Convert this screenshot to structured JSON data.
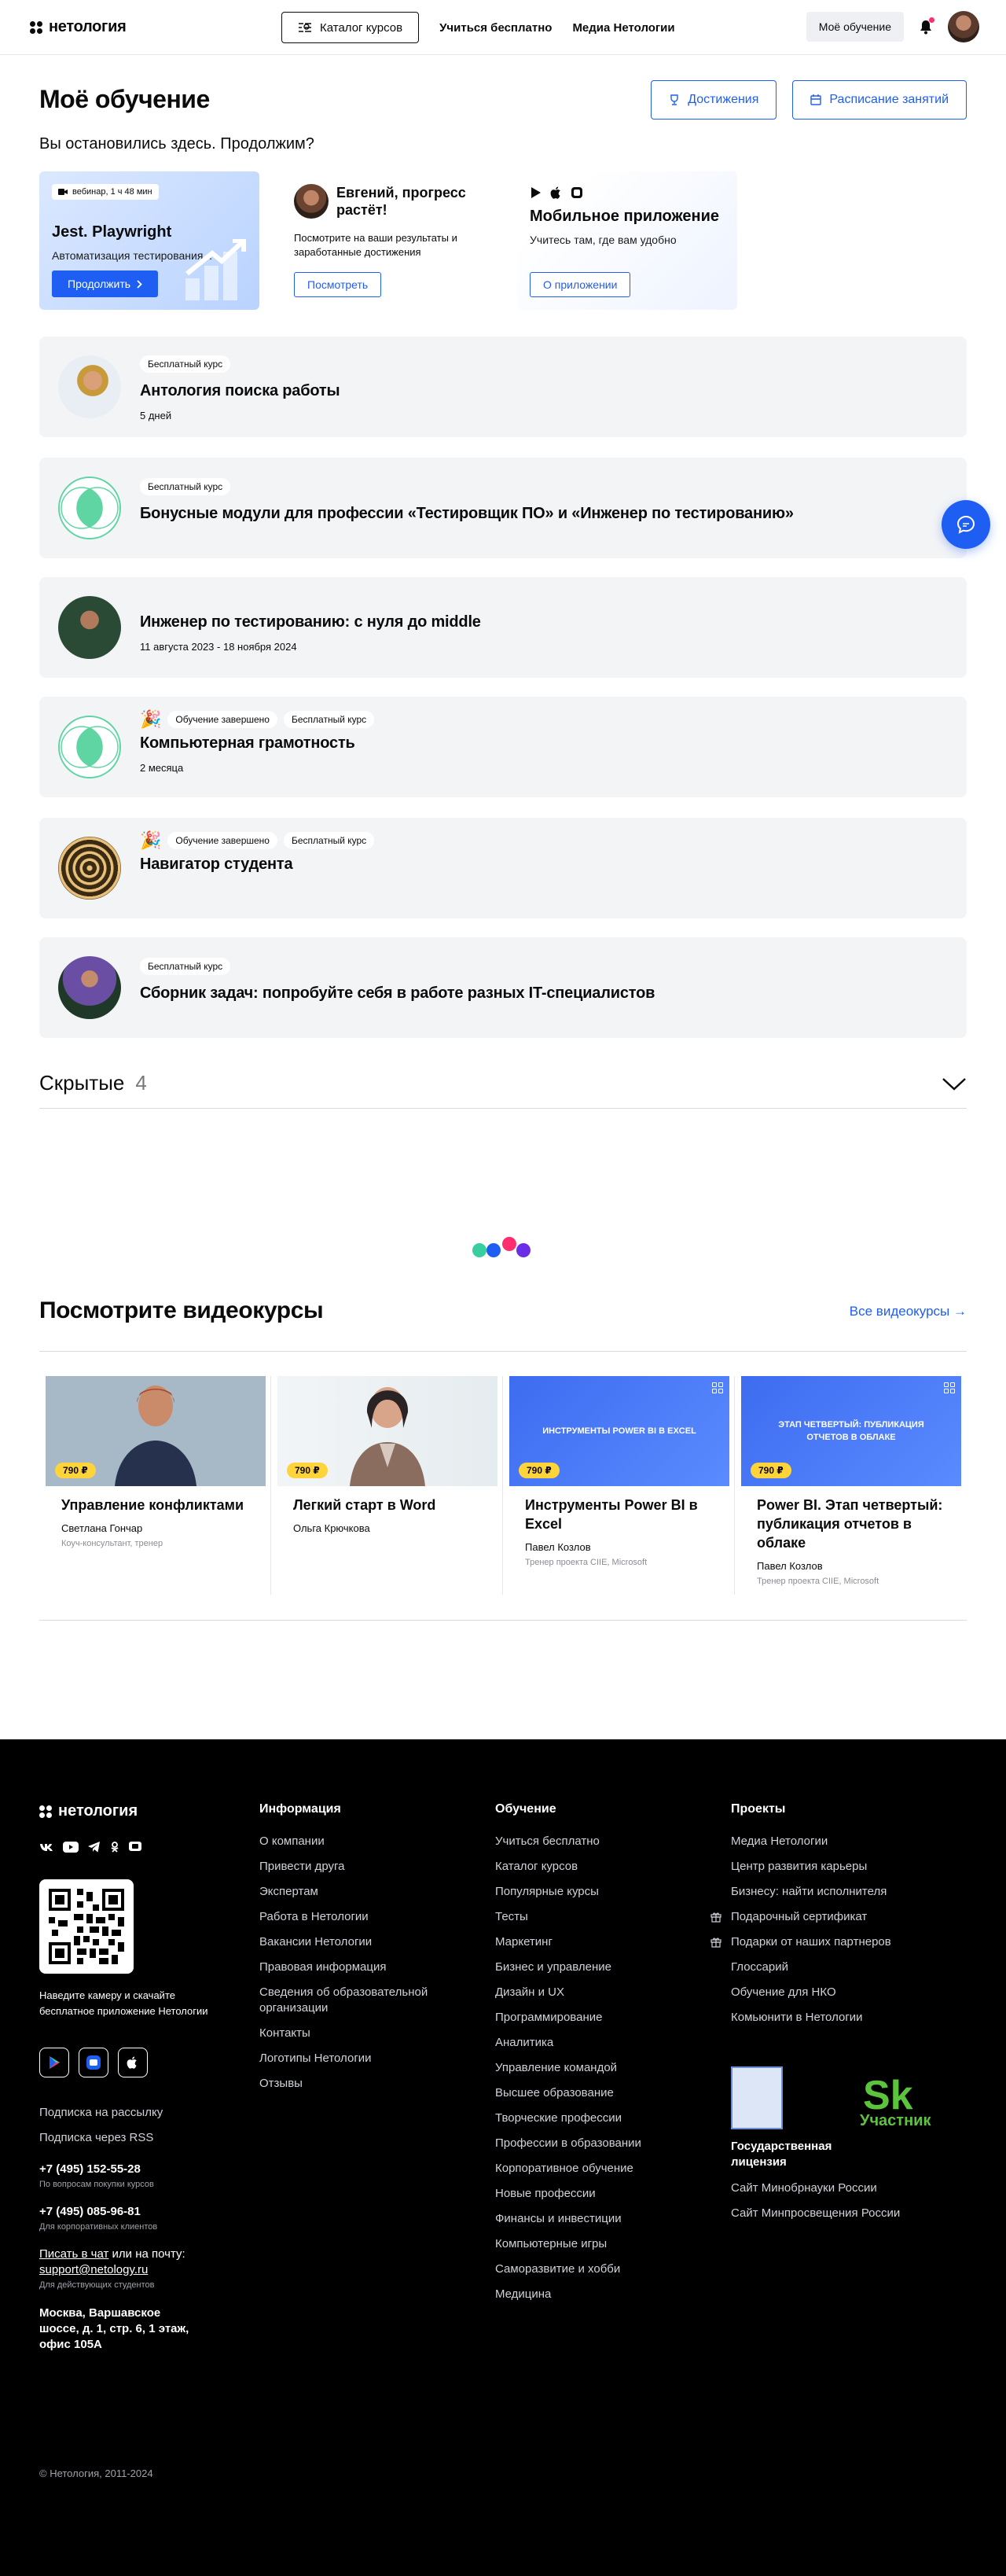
{
  "header": {
    "logo": "нетология",
    "catalog": "Каталог курсов",
    "learn_free": "Учиться бесплатно",
    "media": "Медиа Нетологии",
    "my_learning": "Моё обучение"
  },
  "main": {
    "title": "Моё обучение",
    "achievements": "Достижения",
    "schedule": "Расписание занятий",
    "continue": "Вы остановились здесь. Продолжим?"
  },
  "promos": [
    {
      "badge": "вебинар, 1 ч 48 мин",
      "title": "Jest. Playwright",
      "sub": "Автоматизация тестирования...",
      "button": "Продолжить"
    },
    {
      "title": "Евгений, прогресс растёт!",
      "sub": "Посмотрите на ваши результаты и заработанные достижения",
      "button": "Посмотреть"
    },
    {
      "title": "Мобильное приложение",
      "sub": "Учитесь там, где вам удобно",
      "button": "О приложении"
    }
  ],
  "courses": [
    {
      "tags": [
        "Бесплатный курс"
      ],
      "title": "Антология поиска работы",
      "sub": "5 дней"
    },
    {
      "tags": [
        "Бесплатный курс"
      ],
      "title": "Бонусные модули для профессии «Тестировщик ПО» и «Инженер по тестированию»",
      "sub": ""
    },
    {
      "tags": [],
      "title": "Инженер по тестированию: с нуля до middle",
      "sub": "11 августа 2023 - 18 ноября 2024"
    },
    {
      "tags": [
        "Обучение завершено",
        "Бесплатный курс"
      ],
      "title": "Компьютерная грамотность",
      "sub": "2 месяца"
    },
    {
      "tags": [
        "Обучение завершено",
        "Бесплатный курс"
      ],
      "title": "Навигатор студента",
      "sub": ""
    },
    {
      "tags": [
        "Бесплатный курс"
      ],
      "title": "Сборник задач: попробуйте себя в работе разных IT-специалистов",
      "sub": ""
    }
  ],
  "hidden": {
    "label": "Скрытые",
    "count": "4"
  },
  "videos": {
    "title": "Посмотрите видеокурсы",
    "all": "Все видеокурсы →",
    "items": [
      {
        "price": "790 ₽",
        "title": "Управление конфликтами",
        "author": "Светлана Гончар",
        "role": "Коуч-консультант, тренер",
        "image_text": ""
      },
      {
        "price": "790 ₽",
        "title": "Легкий старт в Word",
        "author": "Ольга Крючкова",
        "role": "",
        "image_text": ""
      },
      {
        "price": "790 ₽",
        "title": "Инструменты Power BI в Excel",
        "author": "Павел Козлов",
        "role": "Тренер проекта CIIE, Microsoft",
        "image_text": "ИНСТРУМЕНТЫ POWER BI В EXCEL"
      },
      {
        "price": "790 ₽",
        "title": "Power BI. Этап четвертый: публикация отчетов в облаке",
        "author": "Павел Козлов",
        "role": "Тренер проекта CIIE, Microsoft",
        "image_text": "ЭТАП ЧЕТВЕРТЫЙ: ПУБЛИКАЦИЯ ОТЧЕТОВ В ОБЛАКЕ"
      }
    ]
  },
  "footer": {
    "logo": "нетология",
    "qr_text": "Наведите камеру и скачайте бесплатное приложение Нетологии",
    "subscribe": "Подписка на рассылку",
    "rss": "Подписка через RSS",
    "phone1": "+7 (495) 152-55-28",
    "phone1_note": "По вопросам покупки курсов",
    "phone2": "+7 (495) 085-96-81",
    "phone2_note": "Для корпоративных клиентов",
    "chat_prefix": "Писать в чат",
    "chat_suffix": " или на почту:",
    "email": "support@netology.ru",
    "email_note": "Для действующих студентов",
    "address": "Москва, Варшавское шоссе, д. 1, стр. 6, 1 этаж, офис 105А",
    "copyright": "© Нетология, 2011-2024",
    "col_info": {
      "title": "Информация",
      "items": [
        "О компании",
        "Привести друга",
        "Экспертам",
        "Работа в Нетологии",
        "Вакансии Нетологии",
        "Правовая информация",
        "Сведения об образовательной организации",
        "Контакты",
        "Логотипы Нетологии",
        "Отзывы"
      ]
    },
    "col_learn": {
      "title": "Обучение",
      "items": [
        "Учиться бесплатно",
        "Каталог курсов",
        "Популярные курсы",
        "Тесты",
        "Маркетинг",
        "Бизнес и управление",
        "Дизайн и UX",
        "Программирование",
        "Аналитика",
        "Управление командой",
        "Высшее образование",
        "Творческие профессии",
        "Профессии в образовании",
        "Корпоративное обучение",
        "Новые профессии",
        "Финансы и инвестиции",
        "Компьютерные игры",
        "Саморазвитие и хобби",
        "Медицина"
      ]
    },
    "col_projects": {
      "title": "Проекты",
      "items": [
        "Медиа Нетологии",
        "Центр развития карьеры",
        "Бизнесу: найти исполнителя",
        "Подарочный сертификат",
        "Подарки от наших партнеров",
        "Глоссарий",
        "Обучение для НКО",
        "Комьюнити в Нетологии"
      ]
    },
    "license": "Государственная лицензия",
    "sk_label": "Участник",
    "minobr": "Сайт Минобрнауки России",
    "minpros": "Сайт Минпросвещения России"
  },
  "colors": {
    "accent": "#1e5ef3",
    "card_bg": "#f3f4f6",
    "price": "#ffd43b"
  }
}
